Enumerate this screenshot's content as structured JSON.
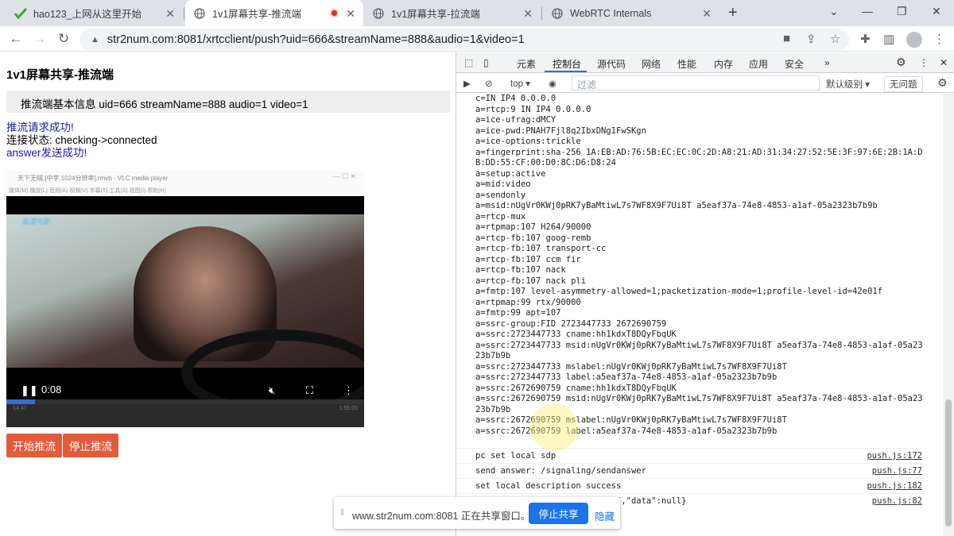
{
  "tabs": [
    {
      "title": "hao123_上网从这里开始",
      "active": false
    },
    {
      "title": "1v1屏幕共享-推流端",
      "active": true
    },
    {
      "title": "1v1屏幕共享-拉流端",
      "active": false
    },
    {
      "title": "WebRTC Internals",
      "active": false
    }
  ],
  "window_controls": {
    "minimize": "—",
    "restore": "❐",
    "close": "✕",
    "tab_search": "⌄",
    "new_tab": "+"
  },
  "address": {
    "url": "str2num.com:8081/xrtcclient/push?uid=666&streamName=888&audio=1&video=1"
  },
  "page": {
    "title": "1v1屏幕共享-推流端",
    "info": "推流端基本信息 uid=666 streamName=888 audio=1 video=1",
    "status1": "推流请求成功!",
    "status2": "连接状态: checking->connected",
    "status3": "answer发送成功!",
    "video": {
      "vlc_title": "天下无贼.[中字.1024分辨率].rmvb - VLC media player",
      "vlc_menu": "媒体(M)  播放(L)  音频(A)  视频(V)  字幕(T)  工具(S)  视图(I)  帮助(H)",
      "vlc_time_left": "14:47",
      "vlc_time_right": "1:55:05",
      "channel_logo": "高清电影",
      "time": "0:08",
      "progress": 0.08
    },
    "buttons": {
      "start": "开始推流",
      "stop": "停止推流"
    }
  },
  "devtools": {
    "tabs": [
      "元素",
      "控制台",
      "源代码",
      "网络",
      "性能",
      "内存",
      "应用",
      "安全"
    ],
    "more": "»",
    "filter": {
      "context": "top",
      "placeholder": "过滤",
      "levels": "默认级别",
      "issues": "无问题"
    },
    "sdp_lines": "c=IN IP4 0.0.0.0\na=rtcp:9 IN IP4 0.0.0.0\na=ice-ufrag:dMCY\na=ice-pwd:PNAH7Fjl8q2IbxDNg1FwSKgn\na=ice-options:trickle\na=fingerprint:sha-256 1A:EB:AD:76:5B:EC:EC:0C:2D:A8:21:AD:31:34:27:52:5E:3F:97:6E:2B:1A:DB:DD:55:CF:00:D0:8C:D6:D8:24\na=setup:active\na=mid:video\na=sendonly\na=msid:nUgVr0KWj0pRK7yBaMtiwL7s7WF8X9F7Ui8T a5eaf37a-74e8-4853-a1af-05a2323b7b9b\na=rtcp-mux\na=rtpmap:107 H264/90000\na=rtcp-fb:107 goog-remb\na=rtcp-fb:107 transport-cc\na=rtcp-fb:107 ccm fir\na=rtcp-fb:107 nack\na=rtcp-fb:107 nack pli\na=fmtp:107 level-asymmetry-allowed=1;packetization-mode=1;profile-level-id=42e01f\na=rtpmap:99 rtx/90000\na=fmtp:99 apt=107\na=ssrc-group:FID 2723447733 2672690759\na=ssrc:2723447733 cname:hh1kdxT8DQyFbqUK\na=ssrc:2723447733 msid:nUgVr0KWj0pRK7yBaMtiwL7s7WF8X9F7Ui8T a5eaf37a-74e8-4853-a1af-05a2323b7b9b\na=ssrc:2723447733 mslabel:nUgVr0KWj0pRK7yBaMtiwL7s7WF8X9F7Ui8T\na=ssrc:2723447733 label:a5eaf37a-74e8-4853-a1af-05a2323b7b9b\na=ssrc:2672690759 cname:hh1kdxT8DQyFbqUK\na=ssrc:2672690759 msid:nUgVr0KWj0pRK7yBaMtiwL7s7WF8X9F7Ui8T a5eaf37a-74e8-4853-a1af-05a2323b7b9b\na=ssrc:2672690759 mslabel:nUgVr0KWj0pRK7yBaMtiwL7s7WF8X9F7Ui8T\na=ssrc:2672690759 label:a5eaf37a-74e8-4853-a1af-05a2323b7b9b",
    "logs": [
      {
        "text": "pc set local sdp",
        "src": "push.js:172"
      },
      {
        "text": "send answer: /signaling/sendanswer",
        "src": "push.js:77"
      },
      {
        "text": "set local description success",
        "src": "push.js:182"
      },
      {
        "text": "                  {\"errNo\":0,\"errMsg\":\"success\",\"data\":null}",
        "src": "push.js:82"
      }
    ]
  },
  "sharebar": {
    "text": "www.str2num.com:8081 正在共享窗口。",
    "stop": "停止共享",
    "hide": "隐藏"
  }
}
